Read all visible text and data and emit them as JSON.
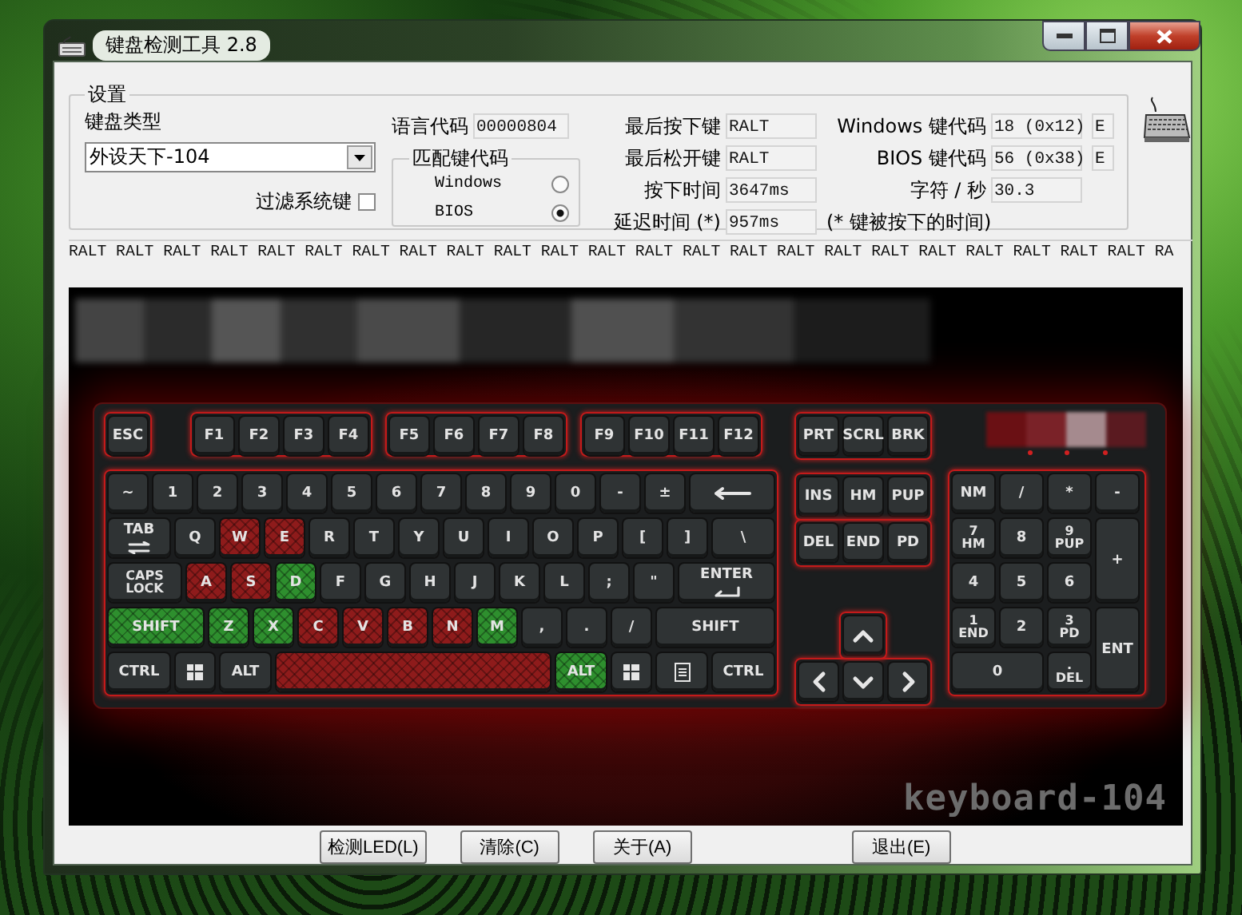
{
  "window": {
    "title": "键盘检测工具 2.8"
  },
  "settings": {
    "title": "设置",
    "keyboard_type_label": "键盘类型",
    "keyboard_type": "外设天下-104",
    "filter_label": "过滤系统键",
    "filter_checked": false,
    "language_label": "语言代码",
    "language_code": "00000804",
    "match_group": {
      "title": "匹配键代码",
      "options": [
        {
          "label": "Windows",
          "selected": false
        },
        {
          "label": "BIOS",
          "selected": true
        }
      ]
    },
    "stats": [
      {
        "label": "最后按下键",
        "value": "RALT"
      },
      {
        "label": "最后松开键",
        "value": "RALT"
      },
      {
        "label": "按下时间",
        "value": "3647ms"
      },
      {
        "label": "延迟时间 (*)",
        "value": "957ms"
      }
    ],
    "codes": [
      {
        "label": "Windows 键代码",
        "value": "18 (0x12)",
        "flag": "E"
      },
      {
        "label": "BIOS 键代码",
        "value": "56 (0x38)",
        "flag": "E"
      },
      {
        "label": "字符 / 秒",
        "value": "30.3"
      }
    ],
    "note": "(* 键被按下的时间)"
  },
  "log": "RALT RALT RALT RALT RALT RALT RALT RALT RALT RALT RALT RALT RALT RALT RALT RALT RALT RALT RALT RALT RALT RALT RALT RA",
  "keyboard": {
    "model": "keyboard-104",
    "function_row": [
      [
        {
          "label": "ESC"
        }
      ],
      [
        {
          "label": "F1"
        },
        {
          "label": "F2"
        },
        {
          "label": "F3"
        },
        {
          "label": "F4"
        }
      ],
      [
        {
          "label": "F5"
        },
        {
          "label": "F6"
        },
        {
          "label": "F7"
        },
        {
          "label": "F8"
        }
      ],
      [
        {
          "label": "F9"
        },
        {
          "label": "F10"
        },
        {
          "label": "F11"
        },
        {
          "label": "F12"
        }
      ]
    ],
    "main_rows": [
      [
        {
          "label": "~"
        },
        {
          "label": "1"
        },
        {
          "label": "2"
        },
        {
          "label": "3"
        },
        {
          "label": "4"
        },
        {
          "label": "5"
        },
        {
          "label": "6"
        },
        {
          "label": "7"
        },
        {
          "label": "8"
        },
        {
          "label": "9"
        },
        {
          "label": "0"
        },
        {
          "label": "-"
        },
        {
          "label": "±"
        },
        {
          "kind": "backspace"
        }
      ],
      [
        {
          "kind": "tab",
          "label": "TAB"
        },
        {
          "label": "Q"
        },
        {
          "label": "W",
          "color": "#8e1b1b"
        },
        {
          "label": "E",
          "color": "#8e1b1b"
        },
        {
          "label": "R"
        },
        {
          "label": "T"
        },
        {
          "label": "Y"
        },
        {
          "label": "U"
        },
        {
          "label": "I"
        },
        {
          "label": "O"
        },
        {
          "label": "P"
        },
        {
          "label": "["
        },
        {
          "label": "]"
        },
        {
          "label": "\\"
        }
      ],
      [
        {
          "label": "CAPS",
          "sub": "LOCK"
        },
        {
          "label": "A",
          "color": "#8e1b1b"
        },
        {
          "label": "S",
          "color": "#8e1b1b"
        },
        {
          "label": "D",
          "color": "#2e8f2e"
        },
        {
          "label": "F"
        },
        {
          "label": "G"
        },
        {
          "label": "H"
        },
        {
          "label": "J"
        },
        {
          "label": "K"
        },
        {
          "label": "L"
        },
        {
          "label": ";"
        },
        {
          "label": "\""
        },
        {
          "kind": "enter",
          "label": "ENTER"
        }
      ],
      [
        {
          "label": "SHIFT",
          "color": "#2e8f2e"
        },
        {
          "label": "Z",
          "color": "#2e8f2e"
        },
        {
          "label": "X",
          "color": "#2e8f2e"
        },
        {
          "label": "C",
          "color": "#8e1b1b"
        },
        {
          "label": "V",
          "color": "#8e1b1b"
        },
        {
          "label": "B",
          "color": "#8e1b1b"
        },
        {
          "label": "N",
          "color": "#8e1b1b"
        },
        {
          "label": "M",
          "color": "#2e8f2e"
        },
        {
          "label": ","
        },
        {
          "label": "."
        },
        {
          "label": "/"
        },
        {
          "label": "SHIFT"
        }
      ],
      [
        {
          "label": "CTRL"
        },
        {
          "kind": "win"
        },
        {
          "label": "ALT"
        },
        {
          "kind": "space",
          "color": "#8e1b1b"
        },
        {
          "label": "ALT",
          "color": "#2e8f2e"
        },
        {
          "kind": "win"
        },
        {
          "kind": "menu"
        },
        {
          "label": "CTRL"
        }
      ]
    ],
    "nav_top": [
      {
        "label": "PRT"
      },
      {
        "label": "SCRL"
      },
      {
        "label": "BRK"
      }
    ],
    "nav_rows": [
      [
        {
          "label": "INS"
        },
        {
          "label": "HM"
        },
        {
          "label": "PUP"
        }
      ],
      [
        {
          "label": "DEL"
        },
        {
          "label": "END"
        },
        {
          "label": "PD"
        }
      ],
      [
        {
          "kind": "up"
        }
      ],
      [
        {
          "kind": "left"
        },
        {
          "kind": "down"
        },
        {
          "kind": "right"
        }
      ]
    ],
    "numpad": [
      {
        "label": "NM"
      },
      {
        "label": "/"
      },
      {
        "label": "*"
      },
      {
        "label": "-"
      },
      {
        "label": "7",
        "sub": "HM"
      },
      {
        "label": "8"
      },
      {
        "label": "9",
        "sub": "PUP"
      },
      {
        "label": "+"
      },
      {
        "label": "4"
      },
      {
        "label": "5"
      },
      {
        "label": "6"
      },
      {
        "label": "1",
        "sub": "END"
      },
      {
        "label": "2"
      },
      {
        "label": "3",
        "sub": "PD"
      },
      {
        "label": "ENT"
      },
      {
        "label": "0"
      },
      {
        "label": ".",
        "sub": "DEL"
      }
    ]
  },
  "buttons": [
    "检测LED(L)",
    "清除(C)",
    "关于(A)",
    "退出(E)"
  ]
}
